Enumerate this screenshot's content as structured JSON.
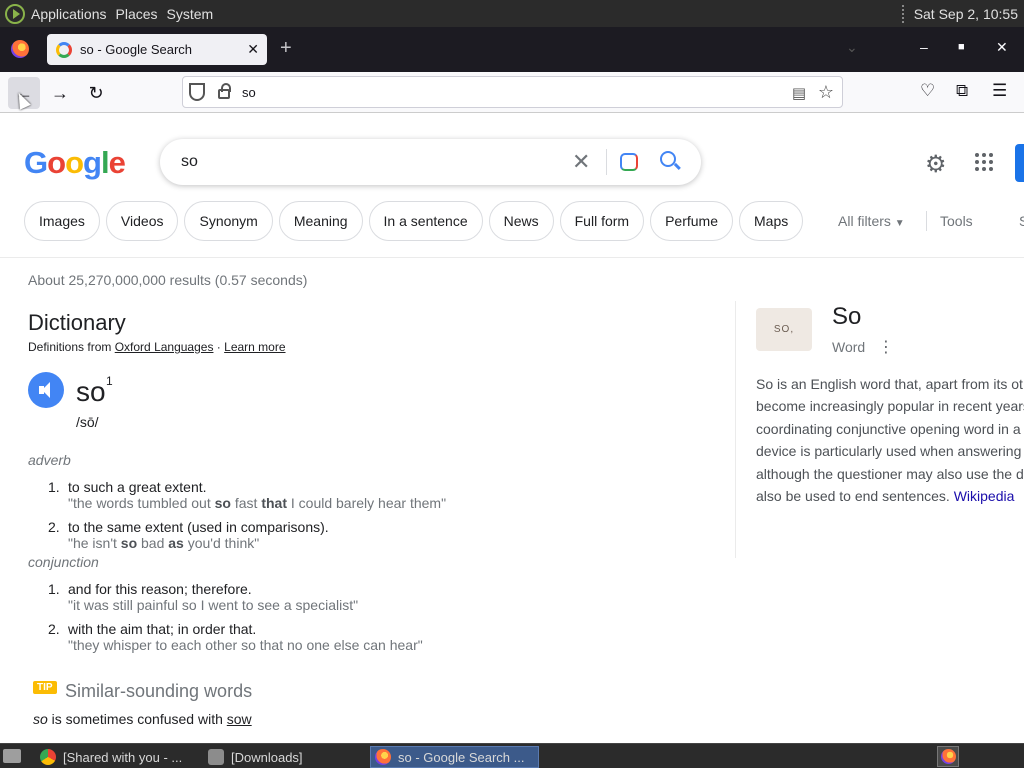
{
  "system_bar": {
    "menu": [
      "Applications",
      "Places",
      "System"
    ],
    "clock": "Sat Sep  2, 10:55"
  },
  "browser": {
    "tab_title": "so - Google Search",
    "url": "so"
  },
  "google": {
    "logo_letters": [
      {
        "ch": "G",
        "color": "#4285f4"
      },
      {
        "ch": "o",
        "color": "#ea4335"
      },
      {
        "ch": "o",
        "color": "#fbbc05"
      },
      {
        "ch": "g",
        "color": "#4285f4"
      },
      {
        "ch": "l",
        "color": "#34a853"
      },
      {
        "ch": "e",
        "color": "#ea4335"
      }
    ],
    "query": "so",
    "chips": [
      "Images",
      "Videos",
      "Synonym",
      "Meaning",
      "In a sentence",
      "News",
      "Full form",
      "Perfume",
      "Maps"
    ],
    "all_filters": "All filters",
    "tools": "Tools",
    "s_fragment": "S",
    "result_stats": "About 25,270,000,000 results (0.57 seconds)"
  },
  "dictionary": {
    "heading": "Dictionary",
    "source_prefix": "Definitions from",
    "source_name": "Oxford Languages",
    "source_sep": " · ",
    "learn_more": "Learn more",
    "word": "so",
    "superscript": "1",
    "pronunciation": "/sō/",
    "pos1": "adverb",
    "def1_num": "1.",
    "def1": "to such a great extent.",
    "ex1_a": "\"the words tumbled out ",
    "ex1_b": "so",
    "ex1_c": " fast ",
    "ex1_d": "that",
    "ex1_e": " I could barely hear them\"",
    "def2_num": "2.",
    "def2": "to the same extent (used in comparisons).",
    "ex2_a": "\"he isn't ",
    "ex2_b": "so",
    "ex2_c": " bad ",
    "ex2_d": "as",
    "ex2_e": " you'd think\"",
    "pos2": "conjunction",
    "def3_num": "1.",
    "def3": "and for this reason; therefore.",
    "ex3": "\"it was still painful so I went to see a specialist\"",
    "def4_num": "2.",
    "def4": "with the aim that; in order that.",
    "ex4": "\"they whisper to each other so that no one else can hear\"",
    "tip_label": "TIP",
    "similar_heading": "Similar-sounding words",
    "confused_word": "so",
    "confused_text": " is sometimes confused with ",
    "confused_link": "sow"
  },
  "knowledge_panel": {
    "thumb_text": "SO,",
    "title": "So",
    "subtitle": "Word",
    "desc_lines": [
      "So is an English word that, apart from its ot",
      "become increasingly popular in recent years",
      "coordinating conjunctive opening word in a",
      "device is particularly used when answering",
      "although the questioner may also use the d",
      "also be used to end sentences. "
    ],
    "wiki_link": "Wikipedia"
  },
  "taskbar": {
    "items": [
      "[Shared with you - ...",
      "[Downloads]",
      "so - Google Search ..."
    ]
  }
}
